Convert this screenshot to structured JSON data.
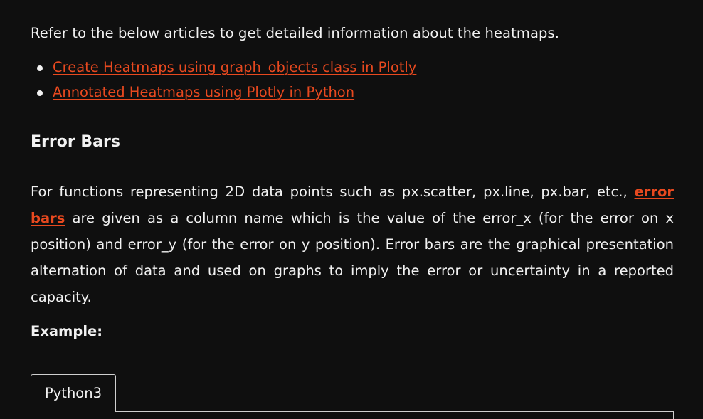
{
  "intro": "Refer to the below articles to get detailed information about the heatmaps.",
  "references": [
    {
      "label": "Create Heatmaps using graph_objects class in Plotly"
    },
    {
      "label": "Annotated Heatmaps using Plotly in Python"
    }
  ],
  "section": {
    "heading": "Error Bars",
    "paragraph": {
      "before_link": "For functions representing 2D data points such as px.scatter, px.line, px.bar, etc., ",
      "link": "error bars",
      "after_link": " are given as a column name which is the value of the error_x (for the error on x position) and error_y (for the error on y position). Error bars are the graphical presentation alternation of data and used on graphs to imply the error or uncertainty in a reported capacity."
    },
    "example_label": "Example:"
  },
  "code_block": {
    "tab_label": "Python3"
  },
  "colors": {
    "background": "#0f0f0f",
    "text": "#f2f2f2",
    "link": "#e8491f"
  }
}
